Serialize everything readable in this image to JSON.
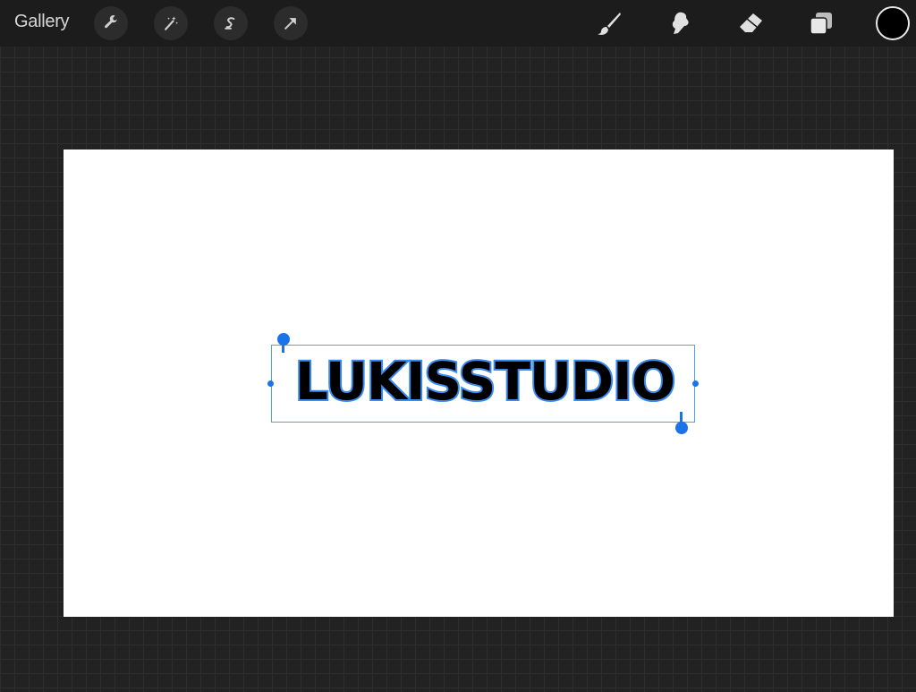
{
  "toolbar": {
    "gallery_label": "Gallery",
    "left_tools": [
      {
        "name": "wrench-icon",
        "meaning": "actions"
      },
      {
        "name": "magic-wand-icon",
        "meaning": "adjustments"
      },
      {
        "name": "selection-icon",
        "meaning": "selection"
      },
      {
        "name": "transform-arrow-icon",
        "meaning": "transform"
      }
    ],
    "right_tools": [
      {
        "name": "brush-icon"
      },
      {
        "name": "smudge-icon"
      },
      {
        "name": "eraser-icon"
      },
      {
        "name": "layers-icon"
      }
    ],
    "current_color": "#000000"
  },
  "canvas": {
    "background": "#ffffff",
    "text_layer": {
      "text": "LUKISSTUDIO",
      "fill_color": "#000000",
      "outline_color": "#3a8bf0"
    },
    "selection_color": "#1a73e8"
  }
}
